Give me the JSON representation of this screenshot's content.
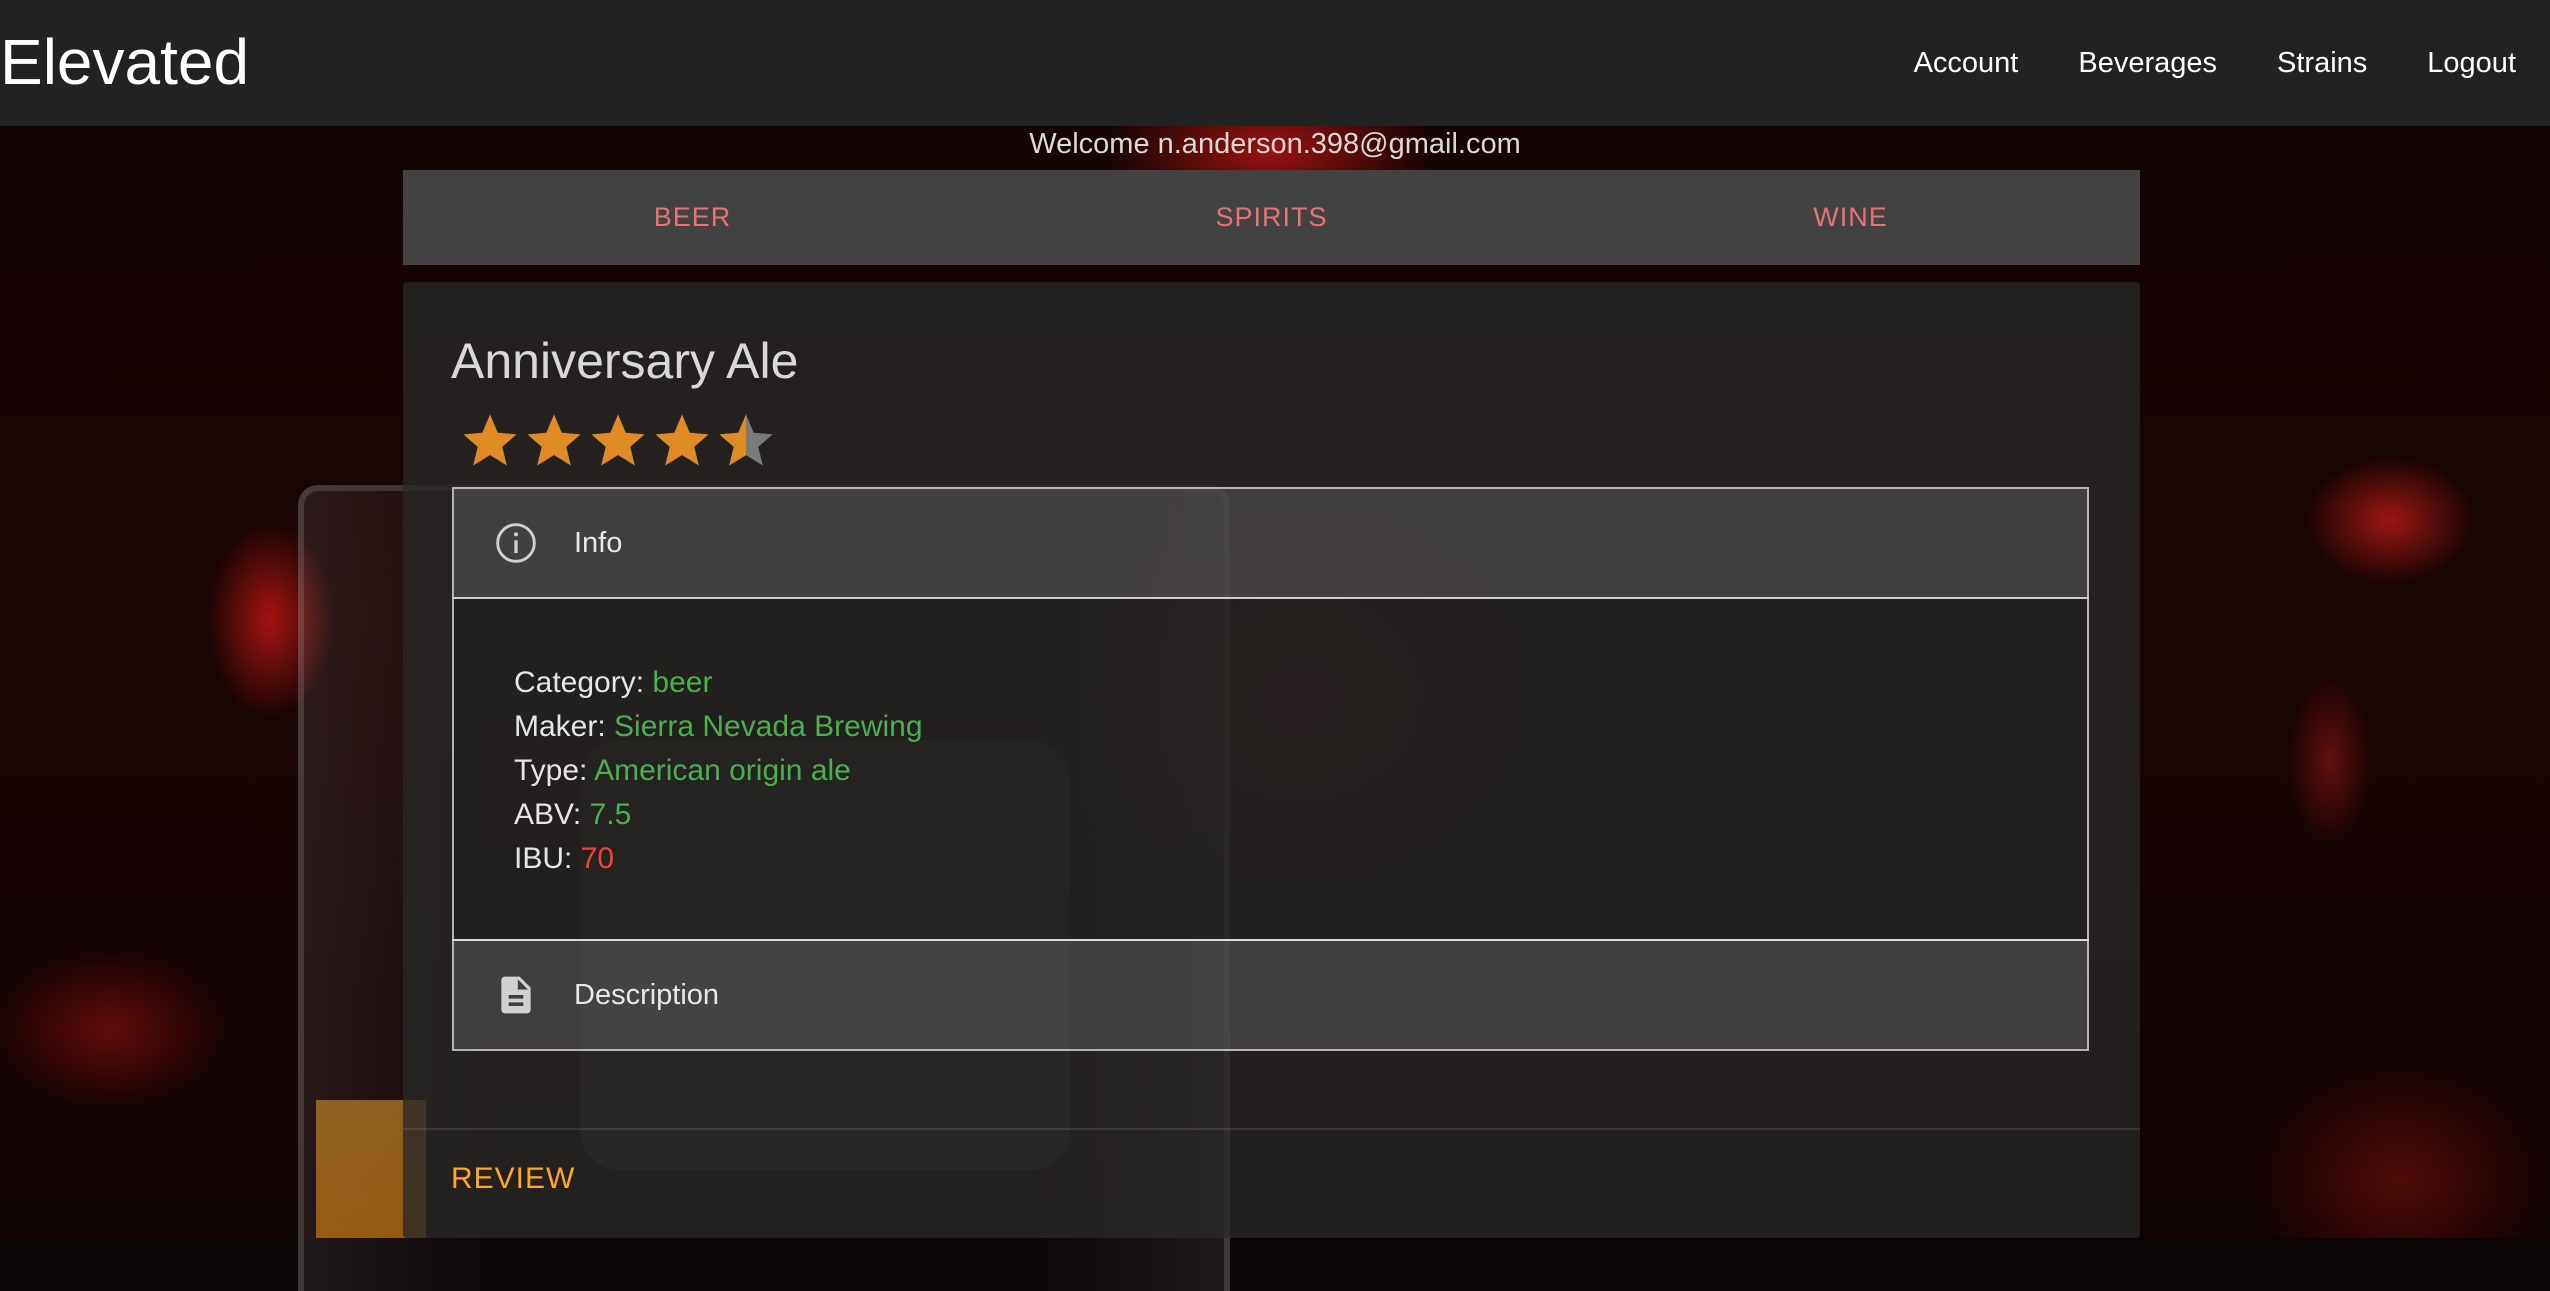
{
  "app": {
    "brand": "Elevated"
  },
  "nav": {
    "items": [
      "Account",
      "Beverages",
      "Strains",
      "Logout"
    ]
  },
  "welcome": "Welcome n.anderson.398@gmail.com",
  "tabs": [
    "BEER",
    "SPIRITS",
    "WINE"
  ],
  "beverage": {
    "name": "Anniversary Ale",
    "rating": 4.5,
    "rating_max": 5,
    "info_label": "Info",
    "description_label": "Description",
    "fields": {
      "category_label": "Category:",
      "category": "beer",
      "maker_label": "Maker:",
      "maker": "Sierra Nevada Brewing",
      "type_label": "Type:",
      "type": "American origin ale",
      "abv_label": "ABV:",
      "abv": "7.5",
      "ibu_label": "IBU:",
      "ibu": "70"
    }
  },
  "review_label": "REVIEW",
  "colors": {
    "tab_text": "#e57373",
    "star": "#e08a25",
    "value_green": "#4caf50",
    "value_red": "#f44336",
    "review": "#ffa726"
  }
}
